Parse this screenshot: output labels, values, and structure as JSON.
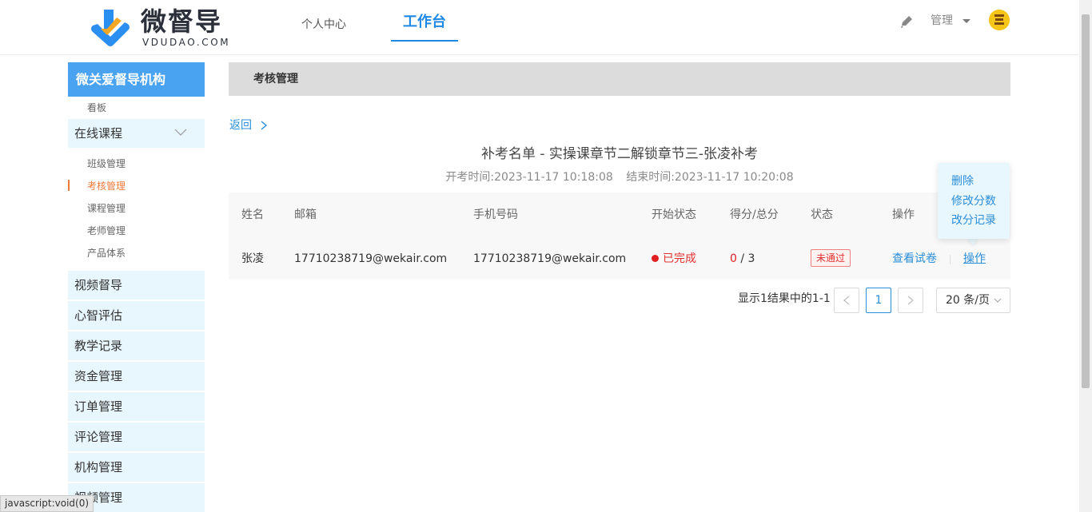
{
  "header": {
    "logo_cn": "微督导",
    "logo_en": "VDUDAO.COM",
    "nav": [
      "个人中心",
      "工作台"
    ],
    "manage_label": "管理",
    "accent": "#1e88e5"
  },
  "sidebar": {
    "org_title": "微关爱督导机构",
    "board": "看板",
    "online_course": "在线课程",
    "online_sub": [
      "班级管理",
      "考核管理",
      "课程管理",
      "老师管理",
      "产品体系"
    ],
    "items": [
      "视频督导",
      "心智评估",
      "教学记录",
      "资金管理",
      "订单管理",
      "评论管理",
      "机构管理",
      "视频管理"
    ]
  },
  "main": {
    "breadcrumb": "考核管理",
    "back": "返回",
    "title": "补考名单 - 实操课章节二解锁章节三-张凌补考",
    "start_time": "开考时间:2023-11-17 10:18:08",
    "end_time": "结束时间:2023-11-17 10:20:08",
    "table": {
      "headers": [
        "姓名",
        "邮箱",
        "手机号码",
        "开始状态",
        "得分/总分",
        "状态",
        "操作"
      ],
      "rows": [
        {
          "name": "张凌",
          "email": "17710238719@wekair.com",
          "phone": "17710238719@wekair.com",
          "start_status": "已完成",
          "score": "0",
          "total": " / 3",
          "status": "未通过",
          "action_view": "查看试卷",
          "action_op": "操作"
        }
      ]
    },
    "popover": [
      "删除",
      "修改分数",
      "改分记录"
    ],
    "pagination": {
      "info": "显示1结果中的1-1",
      "prev": "<",
      "current_page": "1",
      "next": ">",
      "page_size": "20 条/页"
    }
  },
  "status_tip": "javascript:void(0)"
}
